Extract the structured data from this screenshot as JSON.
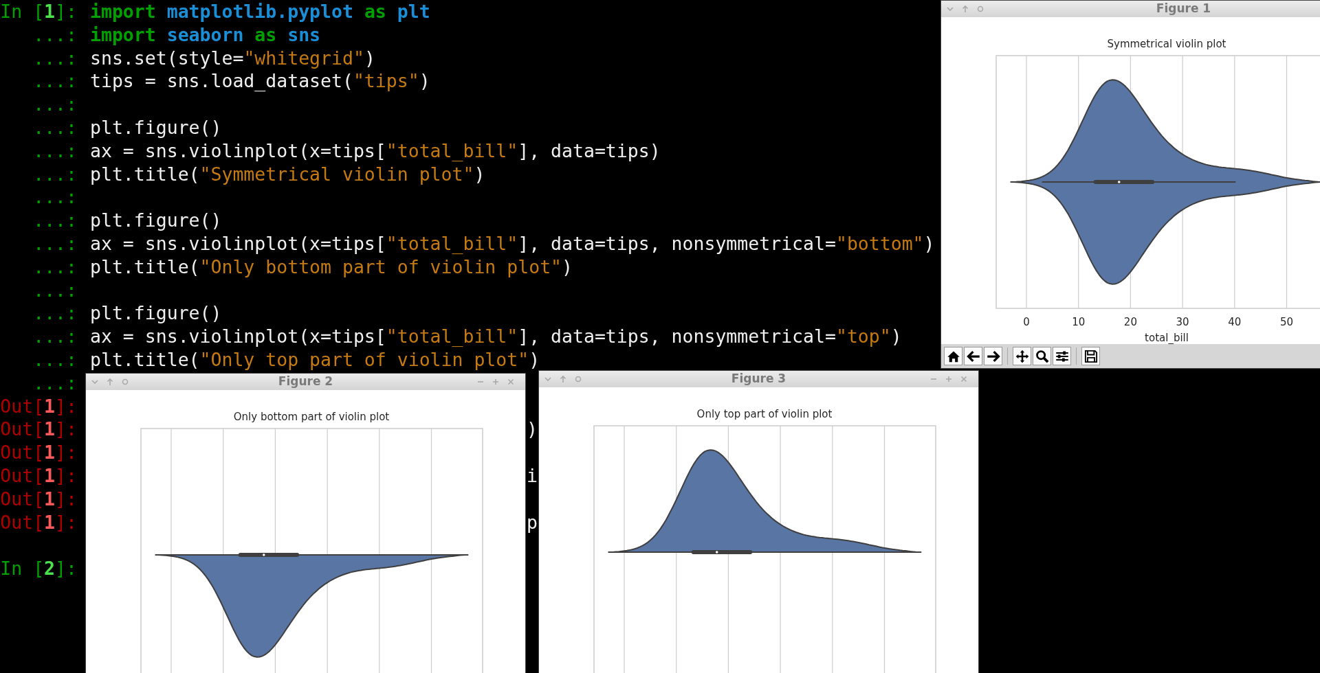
{
  "terminal": {
    "lines": [
      {
        "prompt": [
          {
            "kind": "in",
            "text": "In ["
          },
          {
            "kind": "in-num",
            "text": "1"
          },
          {
            "kind": "in",
            "text": "]:"
          }
        ],
        "code": [
          {
            "kind": "keyword",
            "text": "import "
          },
          {
            "kind": "module",
            "text": "matplotlib.pyplot"
          },
          {
            "kind": "keyword",
            "text": " as "
          },
          {
            "kind": "module",
            "text": "plt"
          }
        ]
      },
      {
        "prompt": [
          {
            "kind": "cont",
            "text": "...:"
          }
        ],
        "code": [
          {
            "kind": "keyword",
            "text": "import "
          },
          {
            "kind": "module",
            "text": "seaborn"
          },
          {
            "kind": "keyword",
            "text": " as "
          },
          {
            "kind": "module",
            "text": "sns"
          }
        ]
      },
      {
        "prompt": [
          {
            "kind": "cont",
            "text": "...:"
          }
        ],
        "code": [
          {
            "kind": "plain",
            "text": "sns.set(style="
          },
          {
            "kind": "string",
            "text": "\"whitegrid\""
          },
          {
            "kind": "plain",
            "text": ")"
          }
        ]
      },
      {
        "prompt": [
          {
            "kind": "cont",
            "text": "...:"
          }
        ],
        "code": [
          {
            "kind": "plain",
            "text": "tips = sns.load_dataset("
          },
          {
            "kind": "string",
            "text": "\"tips\""
          },
          {
            "kind": "plain",
            "text": ")"
          }
        ]
      },
      {
        "prompt": [
          {
            "kind": "cont",
            "text": "...:"
          }
        ]
      },
      {
        "prompt": [
          {
            "kind": "cont",
            "text": "...:"
          }
        ],
        "code": [
          {
            "kind": "plain",
            "text": "plt.figure()"
          }
        ]
      },
      {
        "prompt": [
          {
            "kind": "cont",
            "text": "...:"
          }
        ],
        "code": [
          {
            "kind": "plain",
            "text": "ax = sns.violinplot(x=tips["
          },
          {
            "kind": "string",
            "text": "\"total_bill\""
          },
          {
            "kind": "plain",
            "text": "], data=tips)"
          }
        ]
      },
      {
        "prompt": [
          {
            "kind": "cont",
            "text": "...:"
          }
        ],
        "code": [
          {
            "kind": "plain",
            "text": "plt.title("
          },
          {
            "kind": "string",
            "text": "\"Symmetrical violin plot\""
          },
          {
            "kind": "plain",
            "text": ")"
          }
        ]
      },
      {
        "prompt": [
          {
            "kind": "cont",
            "text": "...:"
          }
        ]
      },
      {
        "prompt": [
          {
            "kind": "cont",
            "text": "...:"
          }
        ],
        "code": [
          {
            "kind": "plain",
            "text": "plt.figure()"
          }
        ]
      },
      {
        "prompt": [
          {
            "kind": "cont",
            "text": "...:"
          }
        ],
        "code": [
          {
            "kind": "plain",
            "text": "ax = sns.violinplot(x=tips["
          },
          {
            "kind": "string",
            "text": "\"total_bill\""
          },
          {
            "kind": "plain",
            "text": "], data=tips, nonsymmetrical="
          },
          {
            "kind": "string",
            "text": "\"bottom\""
          },
          {
            "kind": "plain",
            "text": ")"
          }
        ]
      },
      {
        "prompt": [
          {
            "kind": "cont",
            "text": "...:"
          }
        ],
        "code": [
          {
            "kind": "plain",
            "text": "plt.title("
          },
          {
            "kind": "string",
            "text": "\"Only bottom part of violin plot\""
          },
          {
            "kind": "plain",
            "text": ")"
          }
        ]
      },
      {
        "prompt": [
          {
            "kind": "cont",
            "text": "...:"
          }
        ]
      },
      {
        "prompt": [
          {
            "kind": "cont",
            "text": "...:"
          }
        ],
        "code": [
          {
            "kind": "plain",
            "text": "plt.figure()"
          }
        ]
      },
      {
        "prompt": [
          {
            "kind": "cont",
            "text": "...:"
          }
        ],
        "code": [
          {
            "kind": "plain",
            "text": "ax = sns.violinplot(x=tips["
          },
          {
            "kind": "string",
            "text": "\"total_bill\""
          },
          {
            "kind": "plain",
            "text": "], data=tips, nonsymmetrical="
          },
          {
            "kind": "string",
            "text": "\"top\""
          },
          {
            "kind": "plain",
            "text": ")"
          }
        ]
      },
      {
        "prompt": [
          {
            "kind": "cont",
            "text": "...:"
          }
        ],
        "code": [
          {
            "kind": "plain",
            "text": "plt.title("
          },
          {
            "kind": "string",
            "text": "\"Only top part of violin plot\""
          },
          {
            "kind": "plain",
            "text": ")"
          }
        ]
      },
      {
        "prompt": [
          {
            "kind": "cont",
            "text": "...:"
          }
        ]
      },
      {
        "prompt": [
          {
            "kind": "out",
            "text": "Out["
          },
          {
            "kind": "out-num",
            "text": "1"
          },
          {
            "kind": "out",
            "text": "]:"
          }
        ]
      },
      {
        "prompt": [
          {
            "kind": "out",
            "text": "Out["
          },
          {
            "kind": "out-num",
            "text": "1"
          },
          {
            "kind": "out",
            "text": "]:"
          }
        ],
        "fragment": ")"
      },
      {
        "prompt": [
          {
            "kind": "out",
            "text": "Out["
          },
          {
            "kind": "out-num",
            "text": "1"
          },
          {
            "kind": "out",
            "text": "]:"
          }
        ]
      },
      {
        "prompt": [
          {
            "kind": "out",
            "text": "Out["
          },
          {
            "kind": "out-num",
            "text": "1"
          },
          {
            "kind": "out",
            "text": "]:"
          }
        ],
        "fragment": "i"
      },
      {
        "prompt": [
          {
            "kind": "out",
            "text": "Out["
          },
          {
            "kind": "out-num",
            "text": "1"
          },
          {
            "kind": "out",
            "text": "]:"
          }
        ]
      },
      {
        "prompt": [
          {
            "kind": "out",
            "text": "Out["
          },
          {
            "kind": "out-num",
            "text": "1"
          },
          {
            "kind": "out",
            "text": "]:"
          }
        ],
        "fragment": "p"
      },
      {
        "prompt": [
          {
            "kind": "in",
            "text": "In ["
          },
          {
            "kind": "in-num",
            "text": "2"
          },
          {
            "kind": "in",
            "text": "]:"
          }
        ]
      }
    ]
  },
  "figures": [
    {
      "title": "Figure 1",
      "plot_title": "Symmetrical violin plot",
      "upper_half": true,
      "lower_half": true,
      "xticks": [
        "0",
        "10",
        "20",
        "30",
        "40",
        "50"
      ],
      "xlabel": "total_bill",
      "toolbar": [
        {
          "kind": "home"
        },
        {
          "kind": "back"
        },
        {
          "kind": "forward"
        },
        {
          "kind": "separator"
        },
        {
          "kind": "pan"
        },
        {
          "kind": "zoom"
        },
        {
          "kind": "sliders"
        },
        {
          "kind": "separator"
        },
        {
          "kind": "save"
        }
      ]
    },
    {
      "title": "Figure 2",
      "plot_title": "Only bottom part of violin plot",
      "upper_half": false,
      "lower_half": true,
      "window_controls": true
    },
    {
      "title": "Figure 3",
      "plot_title": "Only top part of violin plot",
      "upper_half": true,
      "lower_half": false,
      "window_controls": true
    }
  ]
}
